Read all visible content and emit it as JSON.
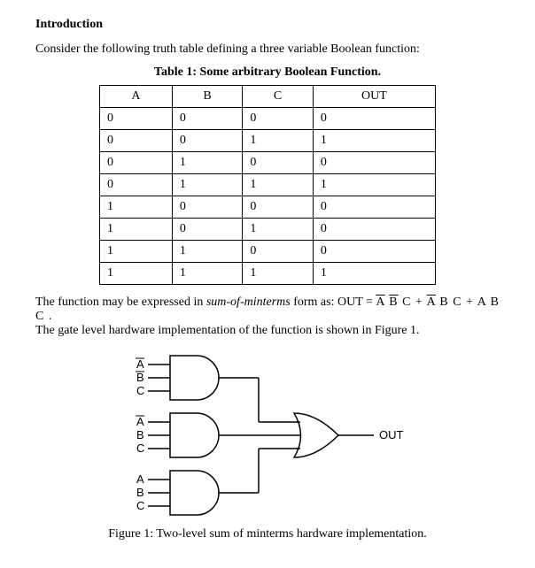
{
  "heading": "Introduction",
  "intro_text": "Consider the following truth table defining a three variable Boolean function:",
  "table_caption": "Table 1: Some arbitrary Boolean Function.",
  "columns": [
    "A",
    "B",
    "C",
    "OUT"
  ],
  "rows": [
    [
      "0",
      "0",
      "0",
      "0"
    ],
    [
      "0",
      "0",
      "1",
      "1"
    ],
    [
      "0",
      "1",
      "0",
      "0"
    ],
    [
      "0",
      "1",
      "1",
      "1"
    ],
    [
      "1",
      "0",
      "0",
      "0"
    ],
    [
      "1",
      "0",
      "1",
      "0"
    ],
    [
      "1",
      "1",
      "0",
      "0"
    ],
    [
      "1",
      "1",
      "1",
      "1"
    ]
  ],
  "sop_prefix": "The function may be expressed in ",
  "sop_em": "sum-of-minterms",
  "sop_mid": " form as:  OUT = ",
  "term1": {
    "a": "A",
    "b": "B",
    "c": "C",
    "a_bar": true,
    "b_bar": true,
    "c_bar": false
  },
  "plus": " + ",
  "term2": {
    "a": "A",
    "b": "B",
    "c": "C",
    "a_bar": true,
    "b_bar": false,
    "c_bar": false
  },
  "term3": {
    "a": "A",
    "b": "B",
    "c": "C",
    "a_bar": false,
    "b_bar": false,
    "c_bar": false
  },
  "sop_end": " .",
  "impl_text": "The gate level hardware implementation of the function is shown in Figure 1.",
  "gate_labels": {
    "g1": [
      "A",
      "B",
      "C"
    ],
    "g2": [
      "A",
      "B",
      "C"
    ],
    "g3": [
      "A",
      "B",
      "C"
    ],
    "bars": {
      "g1": [
        true,
        true,
        false
      ],
      "g2": [
        true,
        false,
        false
      ],
      "g3": [
        false,
        false,
        false
      ]
    },
    "out": "OUT"
  },
  "figure_caption": "Figure 1: Two-level sum of minterms hardware implementation."
}
